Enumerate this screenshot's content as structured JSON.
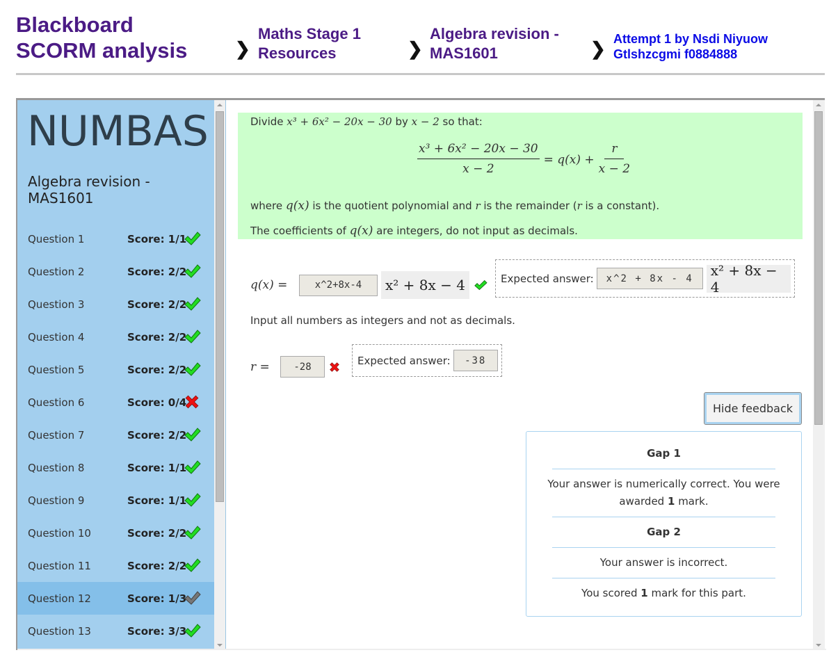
{
  "breadcrumb": {
    "site": "Blackboard SCORM analysis",
    "site_line1": "Blackboard",
    "site_line2": "SCORM analysis",
    "items": [
      {
        "line1": "Maths Stage 1",
        "line2": "Resources",
        "color": "#4b1b85"
      },
      {
        "line1": "Algebra revision -",
        "line2": "MAS1601",
        "color": "#4b1b85"
      },
      {
        "line1": "Attempt 1 by Nsdi Niyuow",
        "line2": "Gtlshzcgmi f0884888",
        "color": "#0b0be6"
      }
    ],
    "separator_icon": "chevron-right-icon",
    "separator_glyph": "❯"
  },
  "sidebar": {
    "logo": "NUMBAS",
    "exam_title_line1": "Algebra revision -",
    "exam_title_line2": "MAS1601",
    "questions": [
      {
        "name": "Question 1",
        "score": "Score: 1/1",
        "status": "correct"
      },
      {
        "name": "Question 2",
        "score": "Score: 2/2",
        "status": "correct"
      },
      {
        "name": "Question 3",
        "score": "Score: 2/2",
        "status": "correct"
      },
      {
        "name": "Question 4",
        "score": "Score: 2/2",
        "status": "correct"
      },
      {
        "name": "Question 5",
        "score": "Score: 2/2",
        "status": "correct"
      },
      {
        "name": "Question 6",
        "score": "Score: 0/4",
        "status": "incorrect"
      },
      {
        "name": "Question 7",
        "score": "Score: 2/2",
        "status": "correct"
      },
      {
        "name": "Question 8",
        "score": "Score: 1/1",
        "status": "correct"
      },
      {
        "name": "Question 9",
        "score": "Score: 1/1",
        "status": "correct"
      },
      {
        "name": "Question 10",
        "score": "Score: 2/2",
        "status": "correct"
      },
      {
        "name": "Question 11",
        "score": "Score: 2/2",
        "status": "correct"
      },
      {
        "name": "Question 12",
        "score": "Score: 1/3",
        "status": "partial",
        "active": true
      },
      {
        "name": "Question 13",
        "score": "Score: 3/3",
        "status": "correct"
      }
    ]
  },
  "statement": {
    "line1_prefix": "Divide ",
    "line1_poly": "x³ + 6x² − 20x − 30",
    "line1_by": " by ",
    "line1_divisor": "x − 2",
    "line1_suffix": " so that:",
    "eq_numerator": "x³ + 6x² − 20x − 30",
    "eq_denominator": "x − 2",
    "eq_middle": "= q(x) +",
    "eq_r_num": "r",
    "eq_r_den": "x − 2",
    "line3_a": "where ",
    "line3_q": "q(x)",
    "line3_b": " is the quotient polynomial and ",
    "line3_r": "r",
    "line3_c": " is the remainder (",
    "line3_r2": "r",
    "line3_d": " is a constant).",
    "line4_a": "The coefficients of ",
    "line4_q": "q(x)",
    "line4_b": " are integers, do not input as decimals."
  },
  "gap1": {
    "label": "q(x) =",
    "value": "x^2+8x-4",
    "preview": "x² + 8x − 4",
    "status": "correct",
    "expected_label": "Expected answer:",
    "expected_value": "x^2 + 8x - 4",
    "expected_preview": "x² + 8x − 4"
  },
  "instruction": "Input all numbers as integers and not as decimals.",
  "gap2": {
    "label": "r =",
    "value": "-28",
    "status": "incorrect",
    "expected_label": "Expected answer:",
    "expected_value": "-38"
  },
  "hide_feedback_label": "Hide feedback",
  "feedback": {
    "gap1_title": "Gap 1",
    "gap1_msg_a": "Your answer is numerically correct. You were",
    "gap1_msg_b_pre": "awarded ",
    "gap1_msg_b_num": "1",
    "gap1_msg_b_post": " mark.",
    "gap2_title": "Gap 2",
    "gap2_msg": "Your answer is incorrect.",
    "summary_pre": "You scored ",
    "summary_num": "1",
    "summary_post": " mark for this part."
  },
  "colors": {
    "purple": "#4b1b85",
    "blue_link": "#0b0be6",
    "sidebar_bg": "#a3cfee",
    "sidebar_active": "#84bfe9",
    "statement_bg": "#ccffcc",
    "correct": "#22dd22",
    "incorrect": "#ee1111",
    "partial": "#777777"
  }
}
